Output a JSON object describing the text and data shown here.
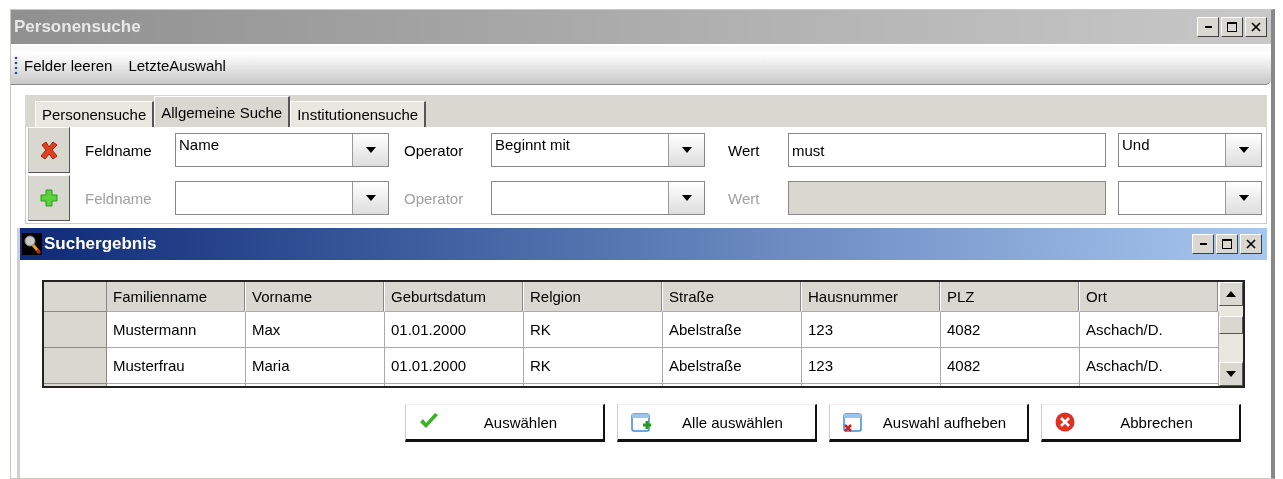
{
  "window": {
    "title": "Personensuche"
  },
  "toolbar": {
    "items": [
      "Felder leeren",
      "LetzteAuswahl"
    ]
  },
  "tabs": [
    {
      "label": "Personensuche",
      "selected": false
    },
    {
      "label": "Allgemeine Suche",
      "selected": true
    },
    {
      "label": "Institutionensuche",
      "selected": false
    }
  ],
  "criteria": [
    {
      "kind": "remove",
      "disabled": false,
      "field_label": "Feldname",
      "field_value": "Name",
      "operator_label": "Operator",
      "operator_value": "Beginnt mit",
      "value_label": "Wert",
      "value": "must",
      "conjunction": "Und"
    },
    {
      "kind": "add",
      "disabled": true,
      "field_label": "Feldname",
      "operator_label": "Operator",
      "value_label": "Wert"
    }
  ],
  "results": {
    "title": "Suchergebnis",
    "table": {
      "columns": [
        "Familienname",
        "Vorname",
        "Geburtsdatum",
        "Relgion",
        "Straße",
        "Hausnummer",
        "PLZ",
        "Ort"
      ],
      "rows": [
        [
          "Mustermann",
          "Max",
          "01.01.2000",
          "RK",
          "Abelstraße",
          "123",
          "4082",
          "Aschach/D."
        ],
        [
          "Musterfrau",
          "Maria",
          "01.01.2000",
          "RK",
          "Abelstraße",
          "123",
          "4082",
          "Aschach/D."
        ]
      ]
    },
    "buttons": [
      {
        "kind": "check",
        "label": "Auswählen"
      },
      {
        "kind": "select_all",
        "label": "Alle auswählen"
      },
      {
        "kind": "deselect",
        "label": "Auswahl aufheben"
      },
      {
        "kind": "cancel",
        "label": "Abbrechen"
      }
    ]
  }
}
